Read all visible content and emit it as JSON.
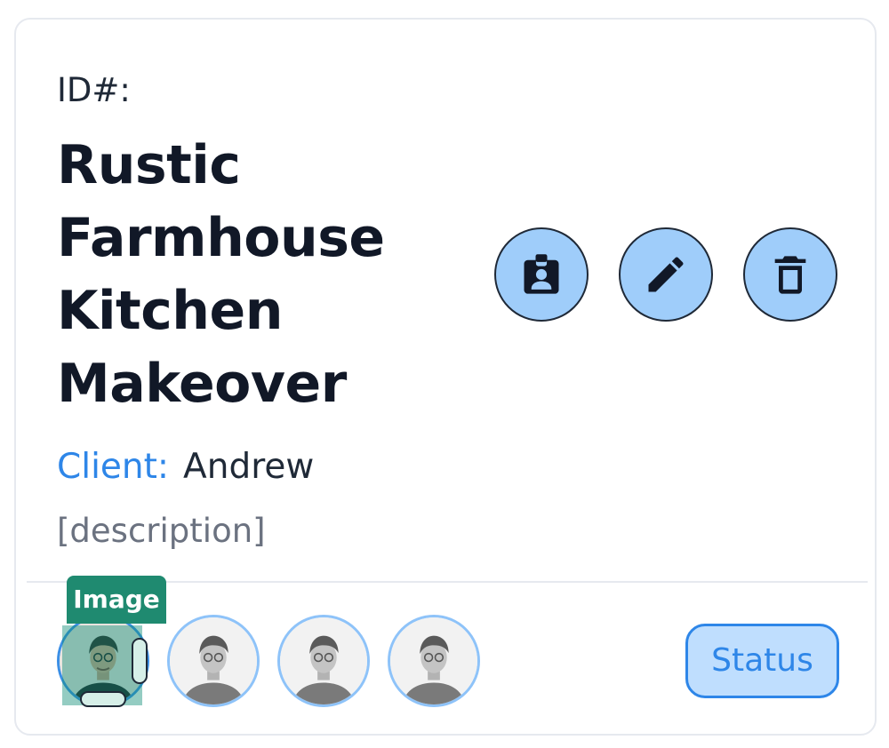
{
  "card": {
    "id_label": "ID#:",
    "title": "Rustic Farmhouse Kitchen Makeover",
    "client_label": "Client:",
    "client_name": "Andrew",
    "description": "[description]"
  },
  "actions": [
    {
      "name": "contact",
      "icon": "contact-badge-icon"
    },
    {
      "name": "edit",
      "icon": "pencil-icon"
    },
    {
      "name": "delete",
      "icon": "trash-icon"
    }
  ],
  "images": {
    "selection_tag": "Image",
    "count": 4,
    "selected_index": 0
  },
  "status": {
    "label": "Status"
  },
  "colors": {
    "accent": "#2e86e8",
    "action_button_fill": "#9fcdfa",
    "status_fill": "#bfdefe",
    "selection_tag": "#1f8a70",
    "avatar_ring": "#8ec3f9"
  }
}
